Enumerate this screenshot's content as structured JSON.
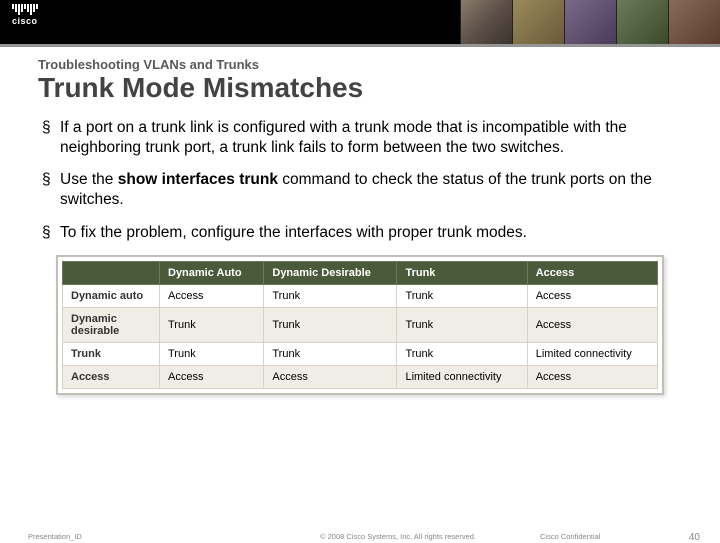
{
  "header": {
    "logo_text": "cisco"
  },
  "section_label": "Troubleshooting VLANs and Trunks",
  "title": "Trunk Mode Mismatches",
  "bullets": [
    {
      "text": "If a port on a trunk link is configured with a trunk mode that is incompatible with the neighboring trunk port, a trunk link fails to form between the two switches."
    },
    {
      "pre": "Use the ",
      "cmd": "show interfaces trunk",
      "post": " command to check the status of the trunk ports on the switches."
    },
    {
      "text": "To fix the problem, configure the interfaces with proper trunk modes."
    }
  ],
  "table": {
    "corner": "",
    "headers": [
      "Dynamic Auto",
      "Dynamic Desirable",
      "Trunk",
      "Access"
    ],
    "rows": [
      {
        "label": "Dynamic auto",
        "cells": [
          "Access",
          "Trunk",
          "Trunk",
          "Access"
        ]
      },
      {
        "label": "Dynamic desirable",
        "cells": [
          "Trunk",
          "Trunk",
          "Trunk",
          "Access"
        ]
      },
      {
        "label": "Trunk",
        "cells": [
          "Trunk",
          "Trunk",
          "Trunk",
          "Limited connectivity"
        ]
      },
      {
        "label": "Access",
        "cells": [
          "Access",
          "Access",
          "Limited connectivity",
          "Access"
        ]
      }
    ]
  },
  "footer": {
    "presentation_id": "Presentation_ID",
    "copyright": "© 2008 Cisco Systems, Inc. All rights reserved.",
    "confidential": "Cisco Confidential",
    "page_num": "40"
  }
}
